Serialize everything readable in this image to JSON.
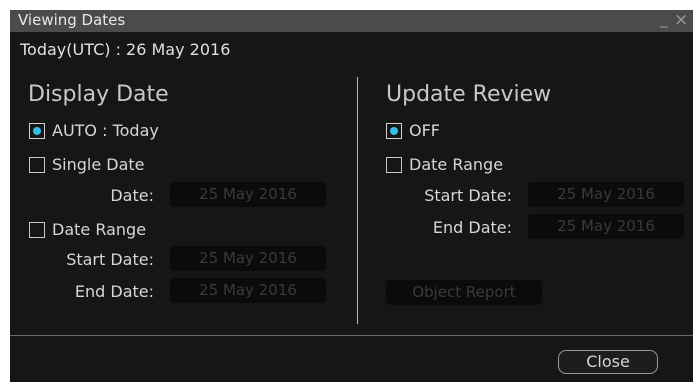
{
  "window": {
    "title": "Viewing Dates",
    "minimize_glyph": "_",
    "close_glyph": "×"
  },
  "today": {
    "text": "Today(UTC) : 26 May 2016"
  },
  "display_date": {
    "title": "Display Date",
    "auto_label": "AUTO : Today",
    "auto_selected": true,
    "single_date_label": "Single Date",
    "single_date_checked": false,
    "date_label": "Date:",
    "date_value": "25 May 2016",
    "date_range_label": "Date Range",
    "date_range_checked": false,
    "start_date_label": "Start Date:",
    "start_date_value": "25 May 2016",
    "end_date_label": "End  Date:",
    "end_date_value": "25 May 2016"
  },
  "update_review": {
    "title": "Update Review",
    "off_label": "OFF",
    "off_selected": true,
    "date_range_label": "Date Range",
    "date_range_checked": false,
    "start_date_label": "Start Date:",
    "start_date_value": "25 May 2016",
    "end_date_label": "End  Date:",
    "end_date_value": "25 May 2016",
    "object_report_label": "Object Report"
  },
  "footer": {
    "close_label": "Close"
  },
  "colors": {
    "accent": "#2fc0e8",
    "background": "#161616",
    "titlebar": "#4b4b4b"
  }
}
